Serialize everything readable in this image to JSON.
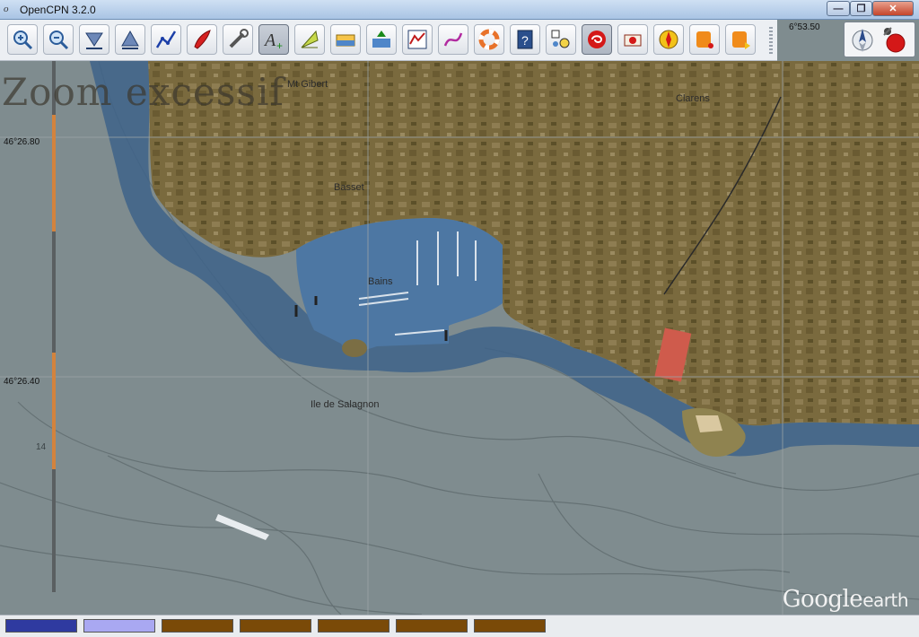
{
  "window": {
    "title": "OpenCPN 3.2.0",
    "app_icon_glyph": "o",
    "minimize_glyph": "—",
    "maximize_glyph": "❐",
    "close_glyph": "✕"
  },
  "toolbar": {
    "tools": [
      {
        "name": "zoom-in-icon",
        "active": false
      },
      {
        "name": "zoom-out-icon",
        "active": false
      },
      {
        "name": "scale-down-icon",
        "active": false
      },
      {
        "name": "scale-up-icon",
        "active": false
      },
      {
        "name": "route-icon",
        "active": false
      },
      {
        "name": "auto-follow-boat-icon",
        "active": false
      },
      {
        "name": "settings-wrench-icon",
        "active": false
      },
      {
        "name": "text-add-icon",
        "active": true
      },
      {
        "name": "current-arrows-icon",
        "active": false
      },
      {
        "name": "tide-icon",
        "active": false
      },
      {
        "name": "current-icon",
        "active": false
      },
      {
        "name": "route-manager-icon",
        "active": false
      },
      {
        "name": "track-icon",
        "active": false
      },
      {
        "name": "mob-lifebuoy-icon",
        "active": false
      },
      {
        "name": "help-book-icon",
        "active": false
      },
      {
        "name": "ais-targets-icon",
        "active": false
      },
      {
        "name": "grib-weather-icon",
        "active": true
      },
      {
        "name": "print-icon",
        "active": false
      },
      {
        "name": "compass-rose-icon",
        "active": false
      },
      {
        "name": "orange-plugin-1-icon",
        "active": false
      },
      {
        "name": "orange-plugin-2-icon",
        "active": false
      }
    ]
  },
  "position": {
    "longitude": "6°53.50"
  },
  "map": {
    "overlay_text": "Zoom excessif",
    "lat_labels": [
      "46°26.80",
      "46°26.40"
    ],
    "places": {
      "mt_gibert": "Mt Gibert",
      "clarens": "Clarens",
      "basset": "Basset",
      "bains": "Bains",
      "ile": "Ile de Salagnon"
    },
    "depth_label": "14",
    "watermark_1": "Google",
    "watermark_2": "earth"
  },
  "statusbar": {
    "chart_bars": [
      {
        "name": "chart-bar-1",
        "color": "#2f3aa0"
      },
      {
        "name": "chart-bar-2",
        "color": "#a9a8f2"
      },
      {
        "name": "chart-bar-3",
        "color": "#7a4a08"
      },
      {
        "name": "chart-bar-4",
        "color": "#7a4a08"
      },
      {
        "name": "chart-bar-5",
        "color": "#7a4a08"
      },
      {
        "name": "chart-bar-6",
        "color": "#7a4a08"
      },
      {
        "name": "chart-bar-7",
        "color": "#7a4a08"
      }
    ]
  }
}
